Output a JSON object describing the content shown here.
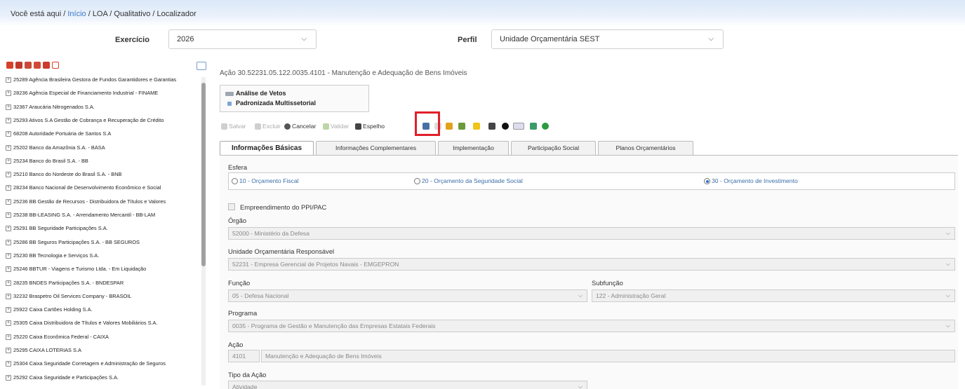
{
  "breadcrumb": {
    "prefix": "Você está aqui /",
    "home": "Início",
    "path": "/ LOA / Qualitativo / Localizador"
  },
  "filters": {
    "exercicio_label": "Exercício",
    "exercicio_value": "2026",
    "perfil_label": "Perfil",
    "perfil_value": "Unidade Orçamentária SEST"
  },
  "tree": {
    "items": [
      "25289 Agência Brasileira Gestora de Fundos Garantidores e Garantias",
      "28236 Agência Especial de Financiamento Industrial - FINAME",
      "32367 Araucária Nitrogenados S.A.",
      "25293 Ativos S.A Gestão de Cobrança e Recuperação de Crédito",
      "68208 Autoridade Portuária de Santos S.A",
      "25202 Banco da Amazônia S.A. - BASA",
      "25234 Banco do Brasil S.A. - BB",
      "25210 Banco do Nordeste do Brasil S.A. - BNB",
      "28234 Banco Nacional de Desenvolvimento Econômico e Social",
      "25236 BB Gestão de Recursos - Distribuidora de Títulos e Valores",
      "25238 BB-LEASING S.A. - Arrendamento Mercantil - BB-LAM",
      "25291 BB Seguridade Participações S.A.",
      "25286 BB Seguros Participações S.A. - BB SEGUROS",
      "25230 BB Tecnologia e Serviços S.A.",
      "25246 BBTUR - Viagens e Turismo Ltda. - Em Liquidação",
      "28235 BNDES Participações S.A. - BNDESPAR",
      "32232 Braspetro Oil Services Company - BRASOIL",
      "25922 Caixa Cartões Holding S.A.",
      "25305 Caixa Distribuidora de Títulos e Valores Mobiliários S.A.",
      "25220 Caixa Econômica Federal - CAIXA",
      "25295 CAIXA LOTERIAS S.A",
      "25304 Caixa Seguridade Corretagem e Administração de Seguros",
      "25292 Caixa Seguridade e Participações S.A."
    ]
  },
  "main": {
    "title": "Ação 30.52231.05.122.0035.4101 - Manutenção e Adequação de Bens Imóveis",
    "info": {
      "line1": "Análise de Vetos",
      "line2": "Padronizada Multissetorial"
    },
    "toolbar": {
      "salvar": "Salvar",
      "excluir": "Excluir",
      "cancelar": "Cancelar",
      "validar": "Validar",
      "espelho": "Espelho"
    },
    "tabs": [
      "Informações Básicas",
      "Informações Complementares",
      "Implementação",
      "Participação Social",
      "Planos Orçamentários"
    ],
    "form": {
      "esfera_label": "Esfera",
      "radios": [
        "10 - Orçamento Fiscal",
        "20 - Orçamento da Seguridade Social",
        "30 - Orçamento de Investimento"
      ],
      "ppi_label": "Empreendimento do PPI/PAC",
      "orgao_label": "Órgão",
      "orgao_value": "52000 - Ministério da Defesa",
      "unidade_label": "Unidade Orçamentária Responsável",
      "unidade_value": "52231 - Empresa Gerencial de Projetos Navais - EMGEPRON",
      "funcao_label": "Função",
      "funcao_value": "05 - Defesa Nacional",
      "subfuncao_label": "Subfunção",
      "subfuncao_value": "122 - Administração Geral",
      "programa_label": "Programa",
      "programa_value": "0035 - Programa de Gestão e Manutenção das Empresas Estatais Federais",
      "acao_label": "Ação",
      "acao_code": "4101",
      "acao_value": "Manutenção e Adequação de Bens Imóveis",
      "tipo_label": "Tipo da Ação",
      "tipo_value": "Atividade"
    }
  },
  "colors": {
    "accent": "#2c6fcf",
    "highlight": "#e0202a",
    "link": "#3a7ac9"
  }
}
